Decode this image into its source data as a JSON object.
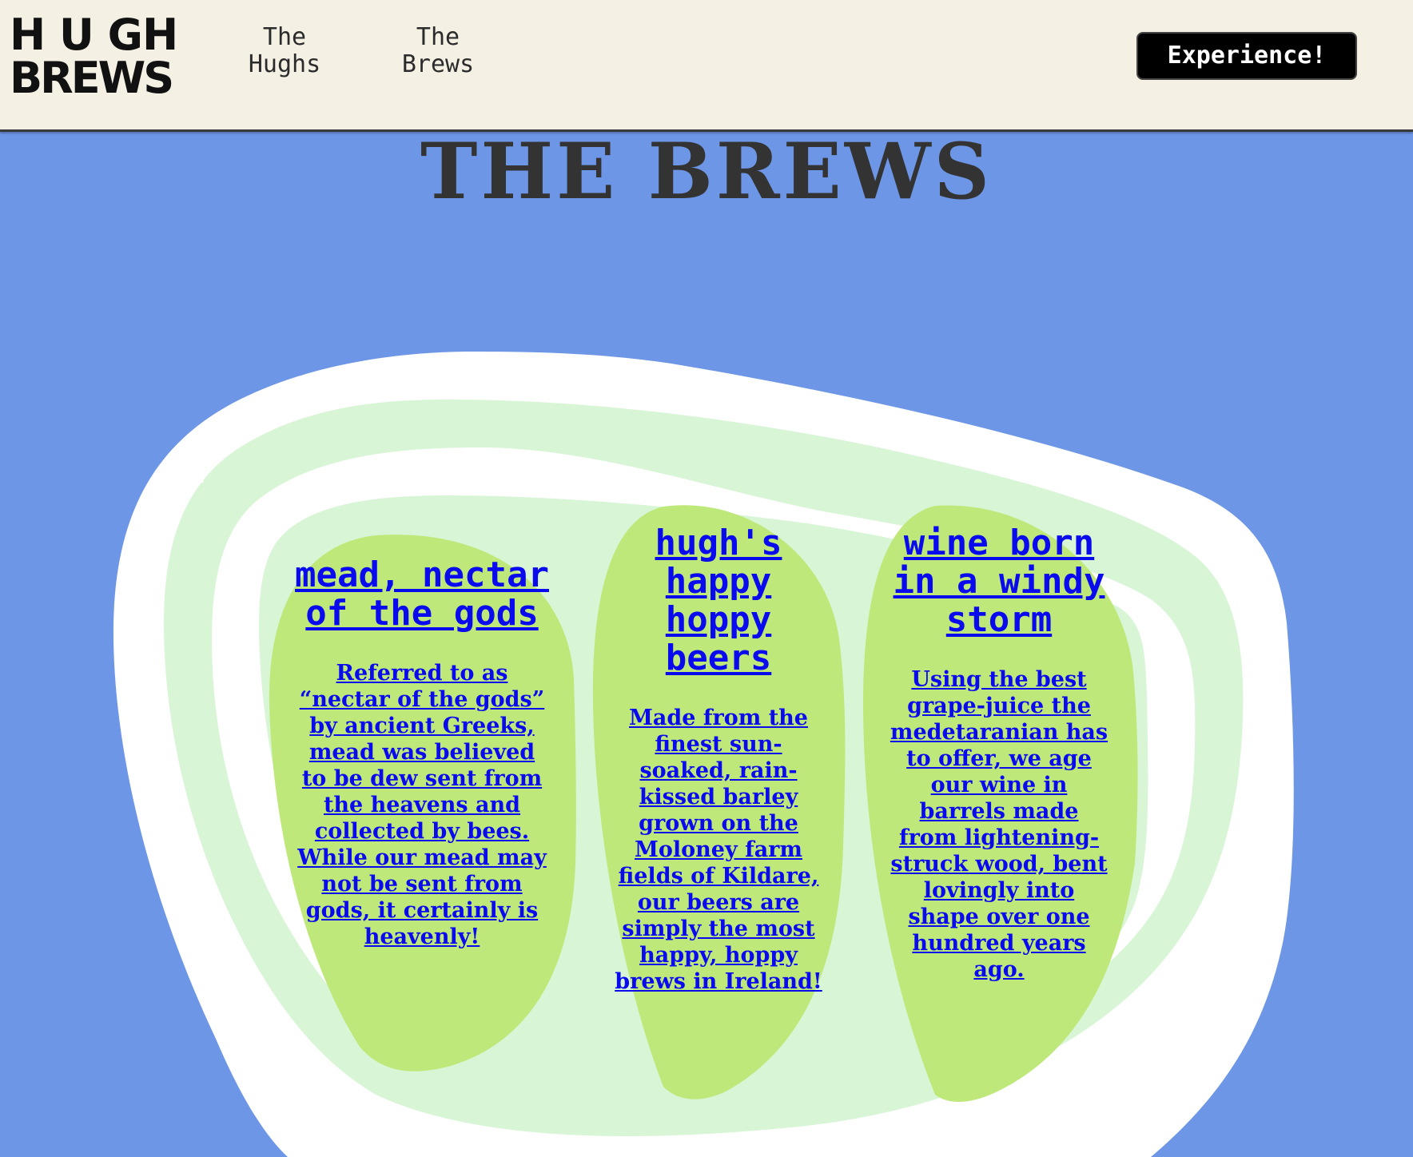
{
  "header": {
    "logo_text": "HUGH'S BREWS",
    "nav": [
      {
        "label": "The\nHughs"
      },
      {
        "label": "The\nBrews"
      }
    ],
    "nav_hughs_line1": "The",
    "nav_hughs_line2": "Hughs",
    "nav_brews_line1": "The",
    "nav_brews_line2": "Brews",
    "cta_label": "Experience!"
  },
  "main": {
    "title": "THE BREWS",
    "cards": [
      {
        "title": "mead, nectar of the gods",
        "body": "Referred to as “nectar of the gods” by ancient Greeks, mead was believed to be dew sent from the heavens and collected by bees. While our mead may not be sent from gods, it certainly is heavenly!"
      },
      {
        "title": "hugh's happy hoppy beers",
        "body": "Made from the finest sun-soaked, rain-kissed barley grown on the Moloney farm fields of Kildare, our beers are simply the most happy, hoppy brews in Ireland!"
      },
      {
        "title": "wine born in a windy storm",
        "body": "Using the best grape-juice the medetaranian has to offer, we age our wine in barrels made from lightening-struck wood, bent lovingly into shape over one hundred years ago."
      }
    ]
  },
  "colors": {
    "background": "#6d96e6",
    "header_bg": "#f5f0e4",
    "blob_outer": "#ffffff",
    "blob_mint": "#d8f5d6",
    "leaf": "#bfe87a",
    "link": "#0a0aee",
    "title": "#333333"
  }
}
